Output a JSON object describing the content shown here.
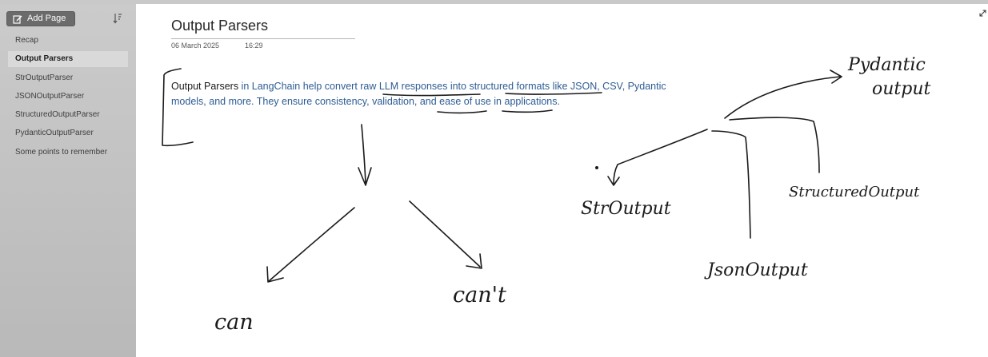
{
  "sidebar": {
    "add_page_label": "Add Page",
    "items": [
      {
        "label": "Recap",
        "active": false
      },
      {
        "label": "Output Parsers",
        "active": true
      },
      {
        "label": "StrOutputParser",
        "active": false
      },
      {
        "label": "JSONOutputParser",
        "active": false
      },
      {
        "label": "StructuredOutputParser",
        "active": false
      },
      {
        "label": "PydanticOutputParser",
        "active": false
      },
      {
        "label": "Some points to remember",
        "active": false
      }
    ]
  },
  "page": {
    "title": "Output Parsers",
    "date": "06 March 2025",
    "time": "16:29",
    "note": {
      "lead": "Output Parsers",
      "seg1": " in LangChain help convert ",
      "seg2": "raw LLM responses",
      "seg3": " into ",
      "seg4": "structured formats",
      "seg5": " like JSON, CSV, Pydantic models, and more. They ensure ",
      "seg6": "consistency",
      "seg7": ", ",
      "seg8": "validation",
      "seg9": ", and ease of use in applications."
    }
  },
  "handwriting": {
    "can": "can",
    "cant": "can't",
    "str_output": "StrOutput",
    "json_output": "JsonOutput",
    "structured_output": "StructuredOutput",
    "pydantic_line1": "Pydantic",
    "pydantic_line2": "output"
  },
  "colors": {
    "sidebar_bg": "#c4c4c4",
    "active_item_bg": "#d9d9d9",
    "note_text": "#2d5c93",
    "ink": "#1a1a1a"
  }
}
